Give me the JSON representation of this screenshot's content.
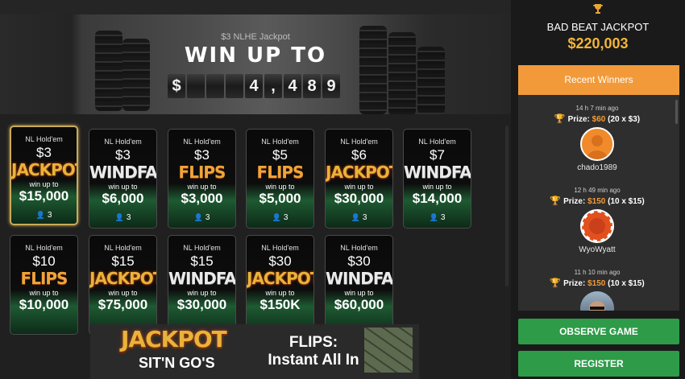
{
  "banner": {
    "subtitle": "$3 NLHE Jackpot",
    "title": "WIN UP TO",
    "counter": [
      "$",
      "",
      "",
      "",
      "4",
      ",",
      "4",
      "8",
      "9"
    ]
  },
  "cards": [
    {
      "type": "NL Hold'em",
      "buyin": "$3",
      "game": "JACKPOT",
      "style": "g-jackpot",
      "win_up_to": "win up to",
      "prize": "$15,000",
      "players": "3",
      "selected": true
    },
    {
      "type": "NL Hold'em",
      "buyin": "$3",
      "game": "WINDFALL",
      "style": "g-windfall",
      "win_up_to": "win up to",
      "prize": "$6,000",
      "players": "3"
    },
    {
      "type": "NL Hold'em",
      "buyin": "$3",
      "game": "FLIPS",
      "style": "g-flips",
      "win_up_to": "win up to",
      "prize": "$3,000",
      "players": "3"
    },
    {
      "type": "NL Hold'em",
      "buyin": "$5",
      "game": "FLIPS",
      "style": "g-flips",
      "win_up_to": "win up to",
      "prize": "$5,000",
      "players": "3"
    },
    {
      "type": "NL Hold'em",
      "buyin": "$6",
      "game": "JACKPOT",
      "style": "g-jackpot",
      "win_up_to": "win up to",
      "prize": "$30,000",
      "players": "3"
    },
    {
      "type": "NL Hold'em",
      "buyin": "$7",
      "game": "WINDFALL",
      "style": "g-windfall",
      "win_up_to": "win up to",
      "prize": "$14,000",
      "players": "3"
    },
    {
      "type": "NL Hold'em",
      "buyin": "$10",
      "game": "FLIPS",
      "style": "g-flips",
      "win_up_to": "win up to",
      "prize": "$10,000",
      "players": ""
    },
    {
      "type": "NL Hold'em",
      "buyin": "$15",
      "game": "JACKPOT",
      "style": "g-jackpot",
      "win_up_to": "win up to",
      "prize": "$75,000",
      "players": ""
    },
    {
      "type": "NL Hold'em",
      "buyin": "$15",
      "game": "WINDFALL",
      "style": "g-windfall",
      "win_up_to": "win up to",
      "prize": "$30,000",
      "players": ""
    },
    {
      "type": "NL Hold'em",
      "buyin": "$30",
      "game": "JACKPOT",
      "style": "g-jackpot",
      "win_up_to": "win up to",
      "prize": "$150K",
      "players": ""
    },
    {
      "type": "NL Hold'em",
      "buyin": "$30",
      "game": "WINDFALL",
      "style": "g-windfall",
      "win_up_to": "win up to",
      "prize": "$60,000",
      "players": ""
    }
  ],
  "ad": {
    "jackpot": "JACKPOT",
    "sitngos": "SIT'N GO'S",
    "flips_line1": "FLIPS:",
    "flips_line2": "Instant All In"
  },
  "sidebar": {
    "jackpot_label": "BAD BEAT JACKPOT",
    "jackpot_value": "$220,003",
    "recent_winners_label": "Recent Winners",
    "winners": [
      {
        "time": "14 h 7 min ago",
        "prize_label": "Prize:",
        "amount": "$60",
        "detail": "(20 x $3)",
        "name": "chado1989",
        "avatar": "person-avatar"
      },
      {
        "time": "12 h 49 min ago",
        "prize_label": "Prize:",
        "amount": "$150",
        "detail": "(10 x $15)",
        "name": "WyoWyatt",
        "avatar": "chip-avatar"
      },
      {
        "time": "11 h 10 min ago",
        "prize_label": "Prize:",
        "amount": "$150",
        "detail": "(10 x $15)",
        "name": "",
        "avatar": "photo-avatar"
      }
    ],
    "observe_label": "OBSERVE GAME",
    "register_label": "REGISTER"
  },
  "colors": {
    "accent_orange": "#f29a3a",
    "button_green": "#2e9b48",
    "jackpot_gold": "#f3b43a"
  }
}
